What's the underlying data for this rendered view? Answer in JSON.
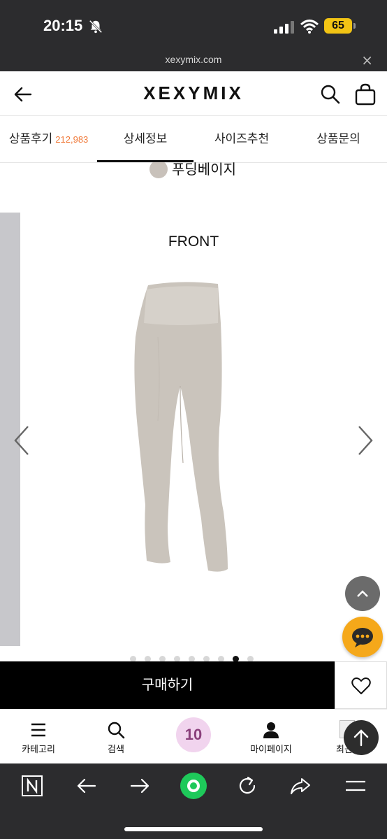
{
  "status_bar": {
    "time": "20:15",
    "battery": "65"
  },
  "browser": {
    "url": "xexymix.com",
    "close_glyph": "×"
  },
  "header": {
    "logo": "XEXYMIX",
    "cart_count": "0"
  },
  "tabs": [
    {
      "label": "상품후기",
      "count": "212,983"
    },
    {
      "label": "상세정보",
      "active": true
    },
    {
      "label": "사이즈추천"
    },
    {
      "label": "상품문의"
    }
  ],
  "product": {
    "color_swatch_label": "푸딩베이지",
    "image_caption": "FRONT",
    "carousel": {
      "total": 9,
      "active_index": 7
    }
  },
  "actions": {
    "buy_label": "구매하기"
  },
  "bottom_nav": {
    "category": "카테고리",
    "search": "검색",
    "promo": "10",
    "mypage": "마이페이지",
    "recent": "최근본"
  },
  "colors": {
    "accent": "#f07a3a",
    "chat": "#f5a81a",
    "buy": "#000000"
  }
}
